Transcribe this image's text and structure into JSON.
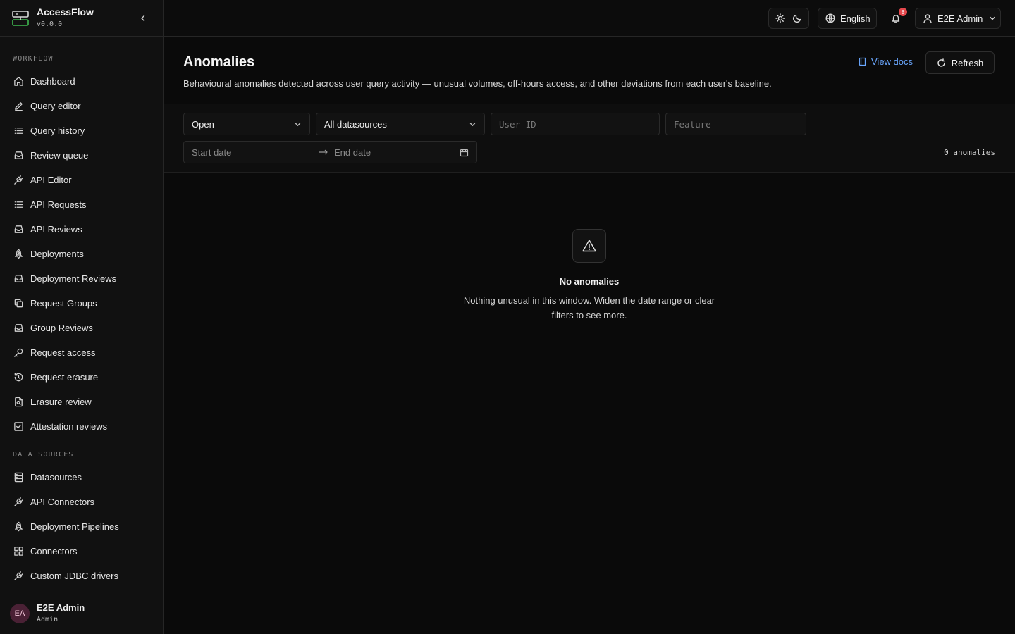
{
  "app": {
    "name": "AccessFlow",
    "version": "v0.0.0"
  },
  "sidebar": {
    "sections": [
      {
        "label": "WORKFLOW"
      },
      {
        "label": "DATA SOURCES"
      }
    ],
    "workflow_items": [
      {
        "label": "Dashboard",
        "icon": "home-icon"
      },
      {
        "label": "Query editor",
        "icon": "pencil-icon"
      },
      {
        "label": "Query history",
        "icon": "list-icon"
      },
      {
        "label": "Review queue",
        "icon": "inbox-icon"
      },
      {
        "label": "API Editor",
        "icon": "plug-icon"
      },
      {
        "label": "API Requests",
        "icon": "list-icon"
      },
      {
        "label": "API Reviews",
        "icon": "inbox-icon"
      },
      {
        "label": "Deployments",
        "icon": "rocket-icon"
      },
      {
        "label": "Deployment Reviews",
        "icon": "inbox-icon"
      },
      {
        "label": "Request Groups",
        "icon": "copy-icon"
      },
      {
        "label": "Group Reviews",
        "icon": "inbox-icon"
      },
      {
        "label": "Request access",
        "icon": "key-icon"
      },
      {
        "label": "Request erasure",
        "icon": "history-icon"
      },
      {
        "label": "Erasure review",
        "icon": "file-search-icon"
      },
      {
        "label": "Attestation reviews",
        "icon": "check-square-icon"
      }
    ],
    "datasource_items": [
      {
        "label": "Datasources",
        "icon": "database-icon"
      },
      {
        "label": "API Connectors",
        "icon": "plug-icon"
      },
      {
        "label": "Deployment Pipelines",
        "icon": "rocket-icon"
      },
      {
        "label": "Connectors",
        "icon": "grid-icon"
      },
      {
        "label": "Custom JDBC drivers",
        "icon": "plug-icon"
      }
    ],
    "user": {
      "initials": "EA",
      "name": "E2E Admin",
      "role": "Admin"
    }
  },
  "topbar": {
    "language": "English",
    "notifications": "8",
    "user": "E2E Admin"
  },
  "page": {
    "title": "Anomalies",
    "description": "Behavioural anomalies detected across user query activity — unusual volumes, off-hours access, and other deviations from each user's baseline.",
    "docs_label": "View docs",
    "refresh_label": "Refresh"
  },
  "filters": {
    "status": "Open",
    "datasource": "All datasources",
    "user_id_placeholder": "User ID",
    "feature_placeholder": "Feature",
    "start_date_placeholder": "Start date",
    "end_date_placeholder": "End date",
    "count_label": "0 anomalies"
  },
  "empty_state": {
    "title": "No anomalies",
    "text": "Nothing unusual in this window. Widen the date range or clear filters to see more."
  },
  "colors": {
    "accent": "#6aa7ff",
    "badge": "#e5484d",
    "logo": "#3fb950"
  }
}
